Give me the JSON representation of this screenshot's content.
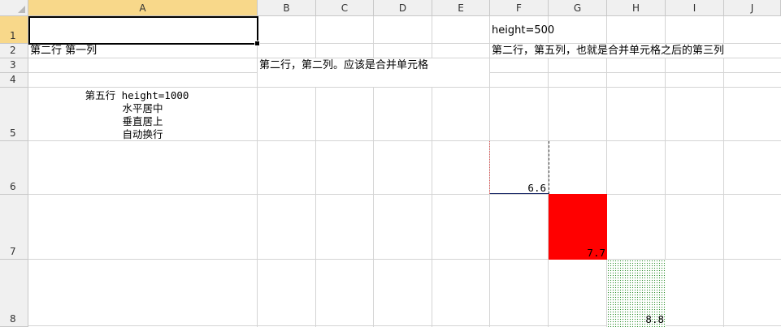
{
  "columns": [
    "A",
    "B",
    "C",
    "D",
    "E",
    "F",
    "G",
    "H",
    "I",
    "J"
  ],
  "rows": [
    "1",
    "2",
    "3",
    "4",
    "5",
    "6",
    "7",
    "8"
  ],
  "selected_column": "A",
  "selected_row": "1",
  "cells": {
    "f1": "height=500",
    "a2": "第二行 第一列",
    "f2": "第二行，第五列，也就是合并单元格之后的第三列",
    "b3": "第二行，第二列。应该是合并单元格",
    "a5_line1": "第五行 height=1000",
    "a5_line2": "水平居中",
    "a5_line3": "垂直居上",
    "a5_line4": "自动换行",
    "f6": "6.6",
    "g7": "7.7",
    "h8": "8.8"
  },
  "colors": {
    "header_bg": "#f0f0f0",
    "header_selected": "#f8d88a",
    "grid": "#d4d4d4",
    "red_fill": "#ff0000",
    "green_pattern": "#2f8f2f",
    "border_blue": "#1f2d6b"
  }
}
